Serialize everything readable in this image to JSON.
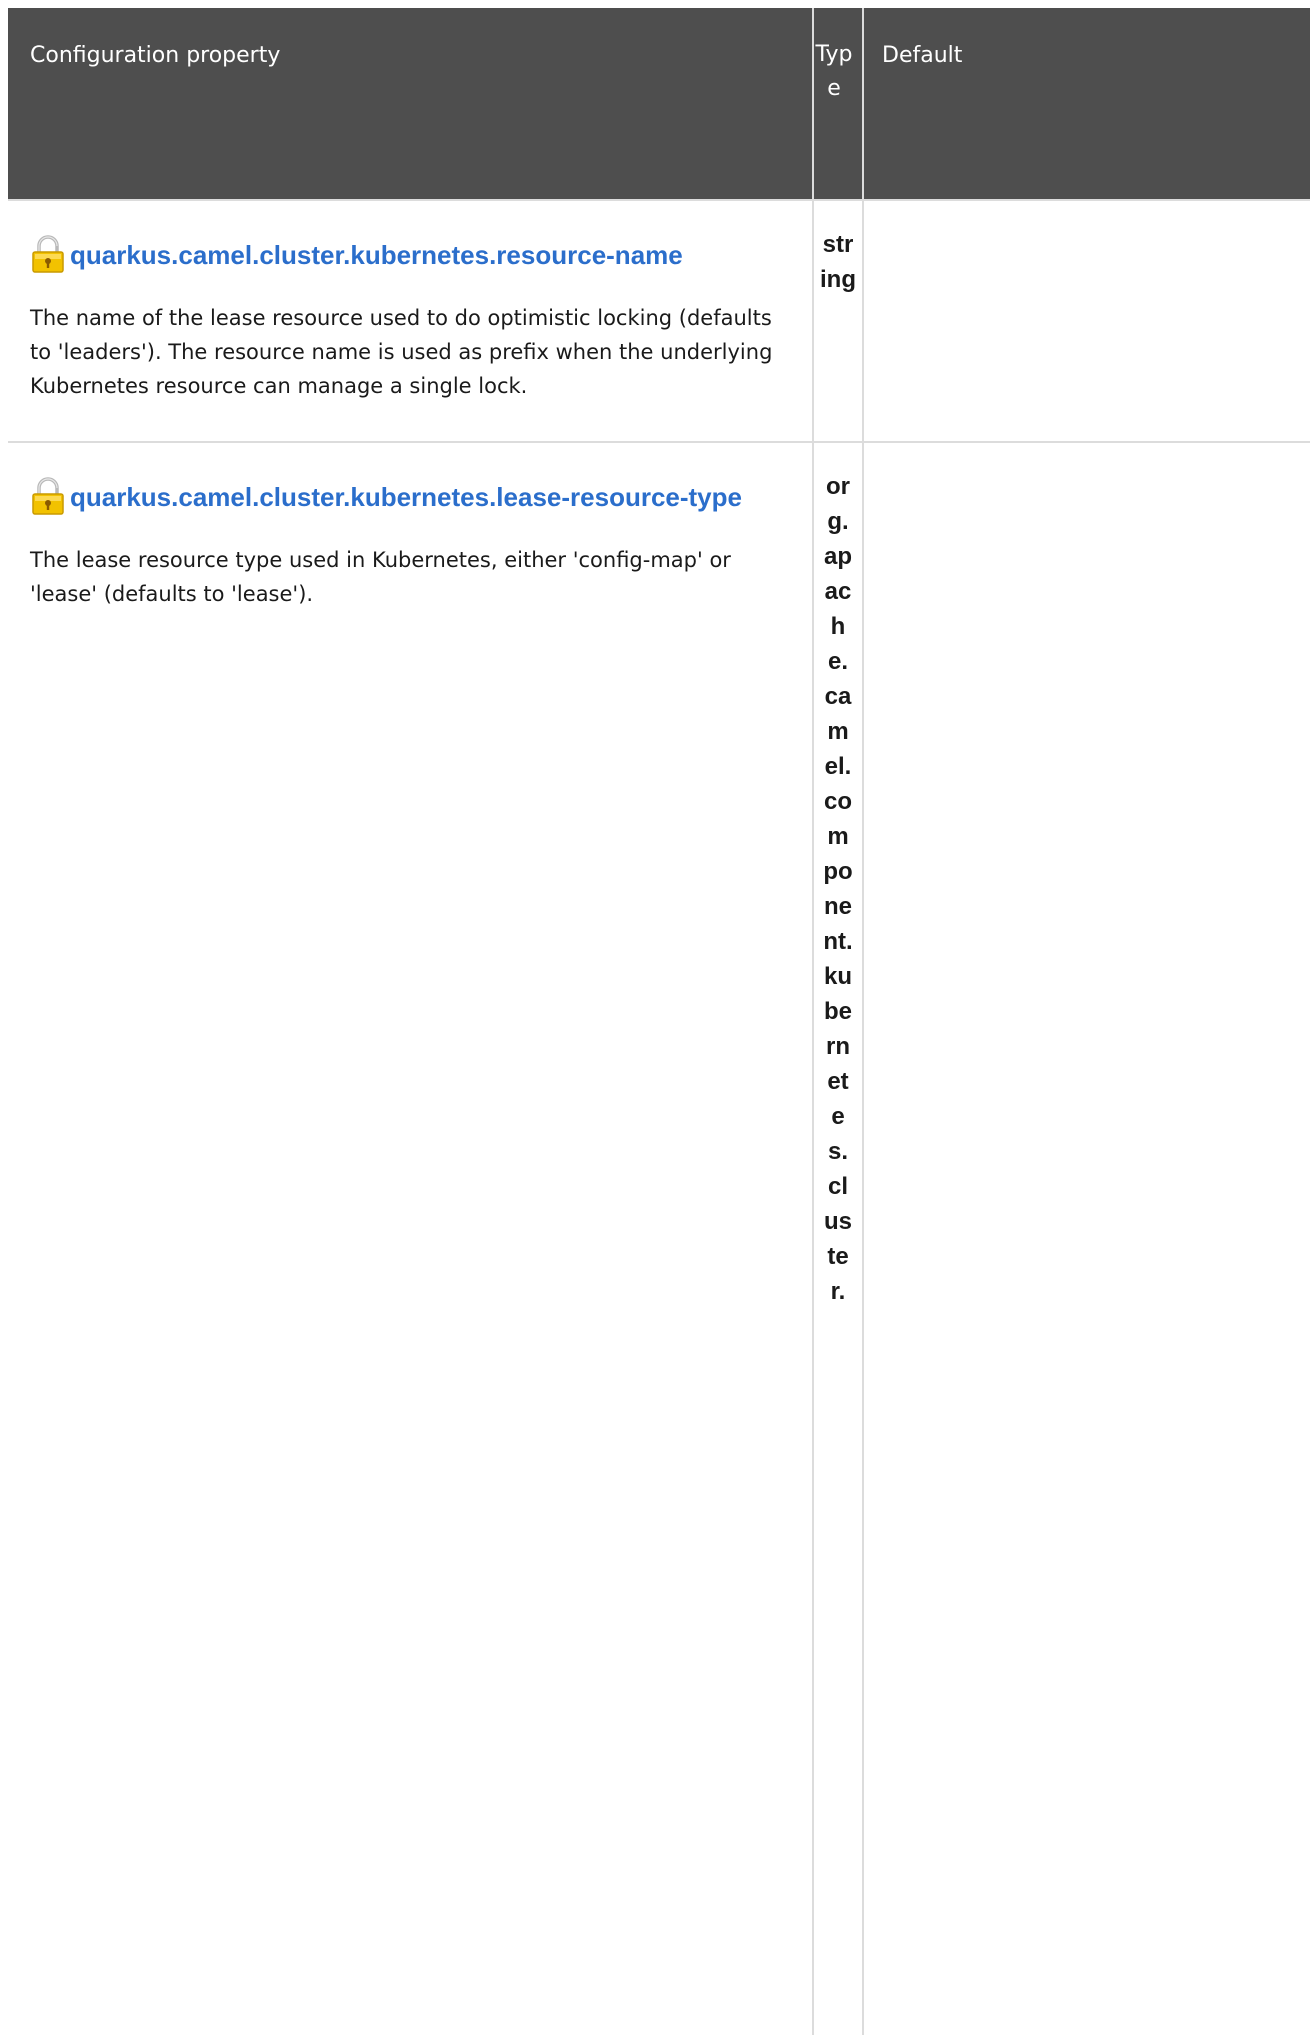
{
  "table": {
    "headers": {
      "property": "Configuration property",
      "type": "Type",
      "default": "Default"
    },
    "rows": [
      {
        "icon": "lock-icon",
        "name": "quarkus.camel.cluster.kubernetes.resource-name",
        "description": "The name of the lease resource used to do optimistic locking (defaults to 'leaders'). The resource name is used as prefix when the underlying Kubernetes resource can manage a single lock.",
        "type": "string",
        "default": ""
      },
      {
        "icon": "lock-icon",
        "name": "quarkus.camel.cluster.kubernetes.lease-resource-type",
        "description": "The lease resource type used in Kubernetes, either 'config-map' or 'lease' (defaults to 'lease').",
        "type": "org.apache.camel.component.kubernetes.cluster.",
        "default": ""
      }
    ]
  },
  "colors": {
    "header_bg": "#4e4e4e",
    "link": "#2b6ecb",
    "border": "#dcdcdc"
  }
}
